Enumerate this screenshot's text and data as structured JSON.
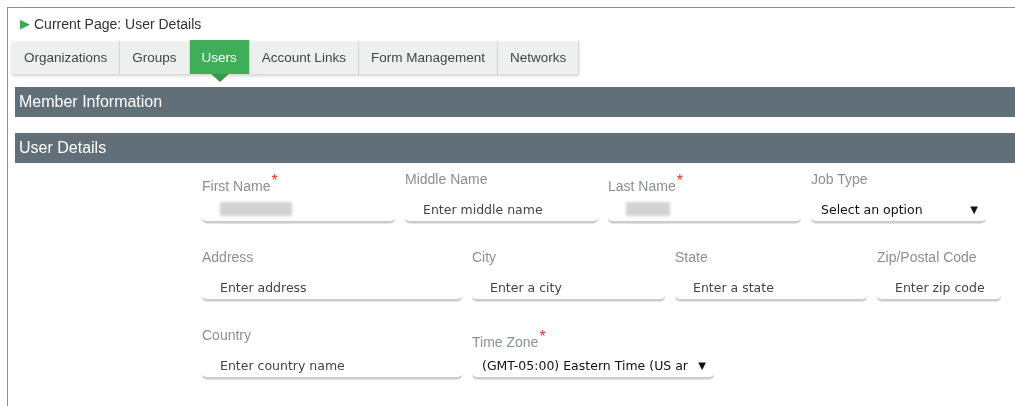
{
  "breadcrumb": {
    "marker": "▶",
    "text": "Current Page: User Details"
  },
  "tabs": [
    {
      "label": "Organizations",
      "selected": false
    },
    {
      "label": "Groups",
      "selected": false
    },
    {
      "label": "Users",
      "selected": true
    },
    {
      "label": "Account Links",
      "selected": false
    },
    {
      "label": "Form Management",
      "selected": false
    },
    {
      "label": "Networks",
      "selected": false
    }
  ],
  "sections": [
    {
      "title": "Member Information"
    },
    {
      "title": "User Details"
    }
  ],
  "form_rows": [
    [
      {
        "label": "First Name",
        "required": true,
        "kind": "input",
        "redacted": true
      },
      {
        "label": "Middle Name",
        "required": false,
        "kind": "input",
        "placeholder": "Enter middle name"
      },
      {
        "label": "Last Name",
        "required": true,
        "kind": "input",
        "redacted": true
      },
      {
        "label": "Job Type",
        "required": false,
        "kind": "select",
        "value": "Select an option",
        "caret": "▼"
      }
    ],
    [
      {
        "label": "Address",
        "required": false,
        "kind": "input",
        "placeholder": "Enter address"
      },
      {
        "label": "City",
        "required": false,
        "kind": "input",
        "placeholder": "Enter a city"
      },
      {
        "label": "State",
        "required": false,
        "kind": "input",
        "placeholder": "Enter a state"
      },
      {
        "label": "Zip/Postal Code",
        "required": false,
        "kind": "input",
        "placeholder": "Enter zip code"
      }
    ],
    [
      {
        "label": "Country",
        "required": false,
        "kind": "input",
        "placeholder": "Enter country name"
      },
      {
        "label": "Time Zone",
        "required": true,
        "kind": "select",
        "value": "(GMT-05:00) Eastern Time (US ar",
        "caret": "▼"
      }
    ]
  ],
  "required_mark": "*"
}
